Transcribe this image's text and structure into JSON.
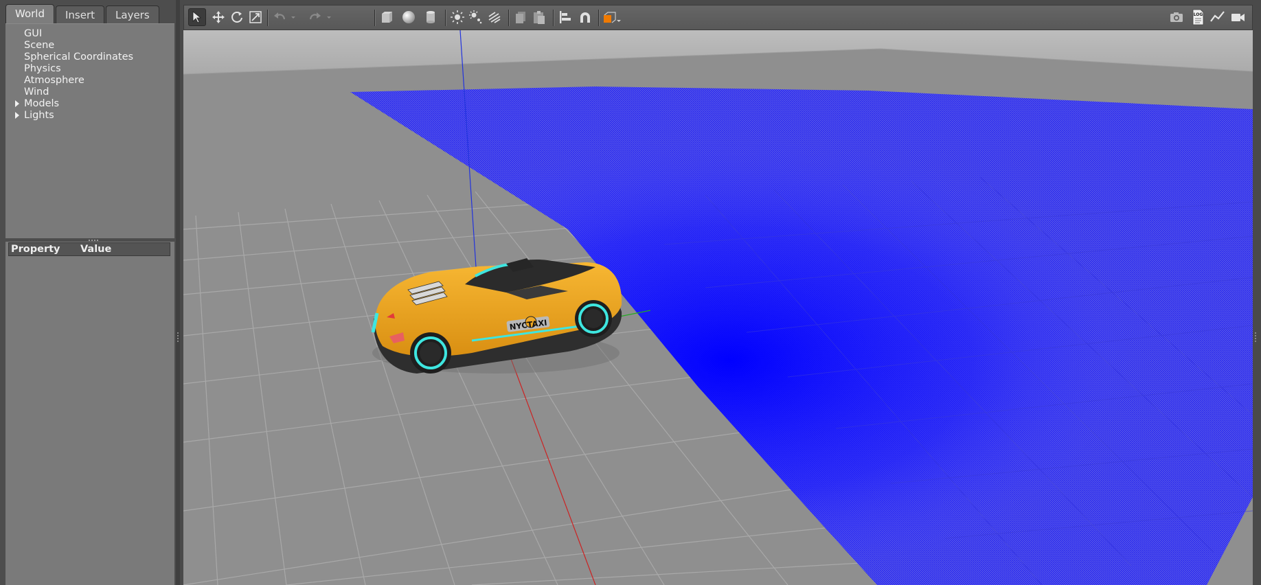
{
  "tabs": [
    {
      "label": "World",
      "active": true
    },
    {
      "label": "Insert",
      "active": false
    },
    {
      "label": "Layers",
      "active": false
    }
  ],
  "world_tree": {
    "items": [
      {
        "label": "GUI",
        "expandable": false
      },
      {
        "label": "Scene",
        "expandable": false
      },
      {
        "label": "Spherical Coordinates",
        "expandable": false
      },
      {
        "label": "Physics",
        "expandable": false
      },
      {
        "label": "Atmosphere",
        "expandable": false
      },
      {
        "label": "Wind",
        "expandable": false
      },
      {
        "label": "Models",
        "expandable": true
      },
      {
        "label": "Lights",
        "expandable": true
      }
    ]
  },
  "properties": {
    "col_property": "Property",
    "col_value": "Value"
  },
  "toolbar": {
    "left_tools": [
      "select-mode",
      "translate-mode",
      "rotate-mode",
      "scale-mode",
      "undo",
      "undo-history",
      "redo",
      "redo-history",
      "box-shape",
      "sphere-shape",
      "cylinder-shape",
      "point-light",
      "spot-light",
      "directional-light",
      "copy",
      "paste",
      "align",
      "snap",
      "view-angle"
    ],
    "right_tools": [
      "screenshot",
      "log",
      "plot",
      "record-video"
    ],
    "log_icon_text": "LOG",
    "active_tool": "select-mode"
  },
  "scene": {
    "vehicle_decal": "NYCTAXI",
    "colors": {
      "sky": "#b4b4b4",
      "ground": "#8f8f8f",
      "grid_line": "#a9a9a9",
      "sensor_field": "#0000ff",
      "car_body": "#f0a823",
      "car_trim": "#2e2e2e",
      "accent": "#3ee6e0",
      "axis_x": "#cc2222",
      "axis_y": "#22aa22",
      "axis_z": "#2233dd"
    }
  }
}
